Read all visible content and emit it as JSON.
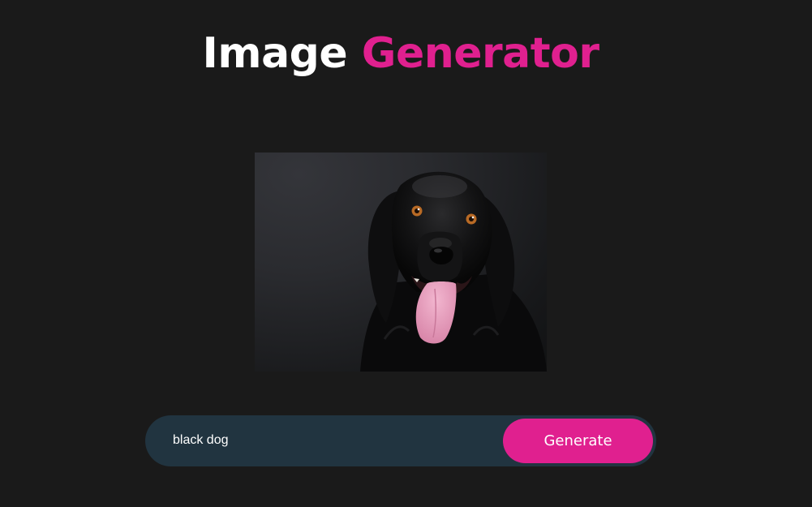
{
  "header": {
    "title_word1": "Image",
    "title_word2": "Generator"
  },
  "image": {
    "subject": "black-dog-photo"
  },
  "prompt": {
    "value": "black dog",
    "button_label": "Generate"
  },
  "colors": {
    "background": "#1a1a1a",
    "accent": "#e0208f",
    "input_bg": "#213440"
  }
}
